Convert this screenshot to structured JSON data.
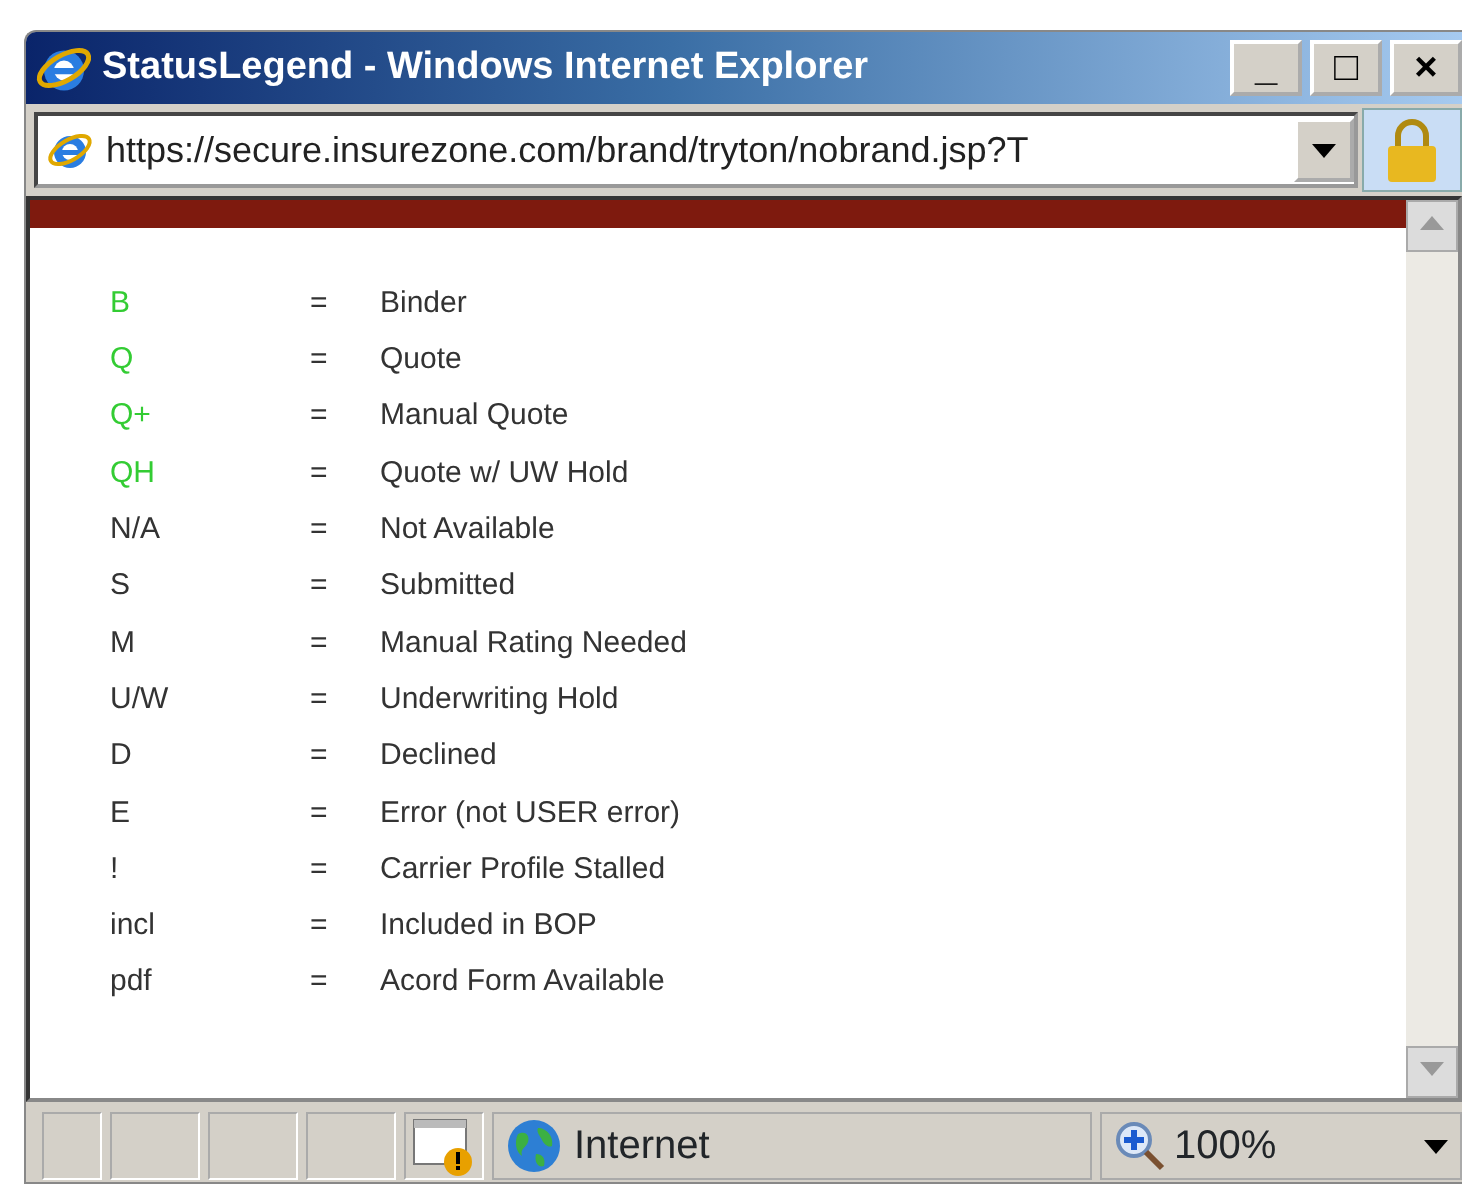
{
  "window": {
    "title": "StatusLegend - Windows Internet Explorer",
    "controls": [
      "_",
      "□",
      "×"
    ]
  },
  "address_bar": {
    "url": "https://secure.insurezone.com/brand/tryton/nobrand.jsp?T"
  },
  "legend": [
    {
      "code": "B",
      "color": "#33cc33",
      "description": "Binder"
    },
    {
      "code": "Q",
      "color": "#33cc33",
      "description": "Quote"
    },
    {
      "code": "Q+",
      "color": "#33cc33",
      "description": "Manual Quote"
    },
    {
      "code": "QH",
      "color": "#33cc33",
      "description": "Quote w/ UW Hold"
    },
    {
      "code": "N/A",
      "color": "#333333",
      "description": "Not Available"
    },
    {
      "code": "S",
      "color": "#333333",
      "description": "Submitted"
    },
    {
      "code": "M",
      "color": "#333333",
      "description": "Manual Rating Needed"
    },
    {
      "code": "U/W",
      "color": "#333333",
      "description": "Underwriting Hold"
    },
    {
      "code": "D",
      "color": "#333333",
      "description": "Declined"
    },
    {
      "code": "E",
      "color": "#333333",
      "description": "Error (not USER error)"
    },
    {
      "code": "!",
      "color": "#333333",
      "description": "Carrier Profile Stalled"
    },
    {
      "code": "incl",
      "color": "#333333",
      "description": "Included in BOP"
    },
    {
      "code": "pdf",
      "color": "#333333",
      "description": "Acord Form Available"
    }
  ],
  "separator": "=",
  "status_bar": {
    "zone": "Internet",
    "zoom": "100%"
  }
}
